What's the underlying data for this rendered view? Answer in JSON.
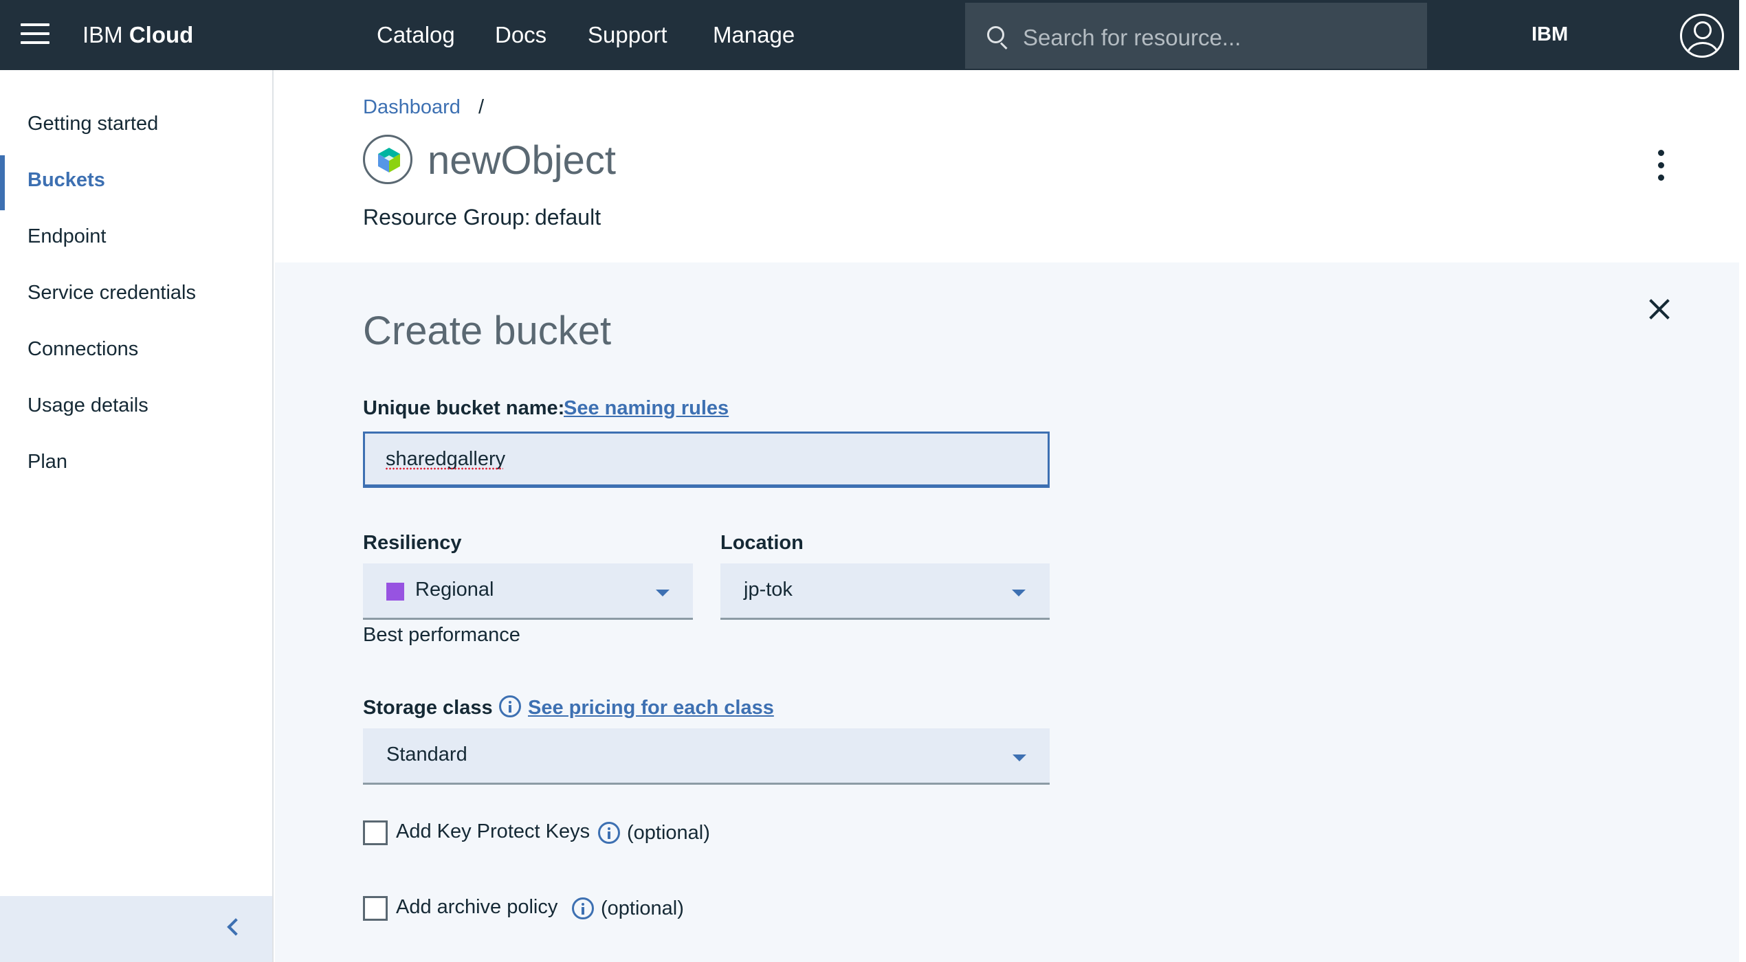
{
  "topbar": {
    "brand_plain": "IBM ",
    "brand_bold": "Cloud",
    "nav": [
      "Catalog",
      "Docs",
      "Support",
      "Manage"
    ],
    "search_placeholder": "Search for resource...",
    "account": "IBM"
  },
  "sidebar": {
    "items": [
      {
        "label": "Getting started",
        "active": false
      },
      {
        "label": "Buckets",
        "active": true
      },
      {
        "label": "Endpoint",
        "active": false
      },
      {
        "label": "Service credentials",
        "active": false
      },
      {
        "label": "Connections",
        "active": false
      },
      {
        "label": "Usage details",
        "active": false
      },
      {
        "label": "Plan",
        "active": false
      }
    ]
  },
  "header": {
    "breadcrumb": "Dashboard",
    "breadcrumb_separator": "/",
    "title": "newObject",
    "resource_group_label": "Resource Group:",
    "resource_group_value": "default"
  },
  "form": {
    "title": "Create bucket",
    "bucket_name_label": "Unique bucket name:",
    "naming_rules_link": "See naming rules",
    "bucket_name_value": "sharedgallery",
    "resiliency_label": "Resiliency",
    "resiliency_value": "Regional",
    "resiliency_color": "#9753e1",
    "resiliency_helper": "Best performance",
    "location_label": "Location",
    "location_value": "jp-tok",
    "storage_class_label": "Storage class",
    "pricing_link": "See pricing for each class",
    "storage_class_value": "Standard",
    "key_protect_label": "Add Key Protect Keys",
    "key_protect_optional": "(optional)",
    "archive_label": "Add archive policy",
    "archive_optional": "(optional)"
  },
  "colors": {
    "topbar_bg": "#21303c",
    "accent": "#3d70b2",
    "panel_bg": "#f4f7fb"
  }
}
